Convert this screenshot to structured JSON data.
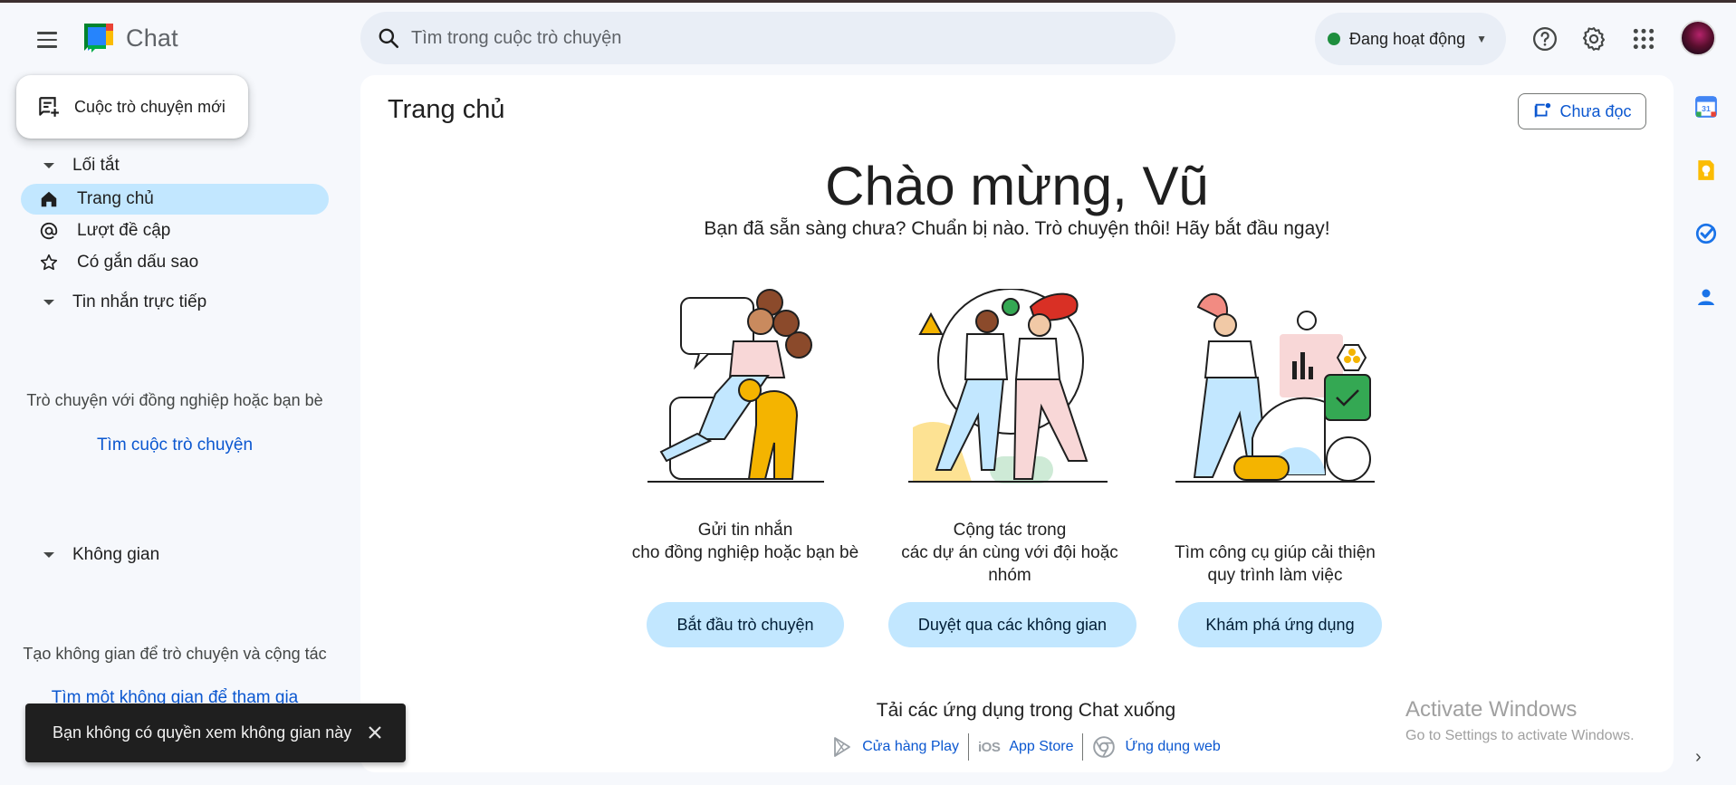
{
  "app": {
    "title": "Chat"
  },
  "search": {
    "placeholder": "Tìm trong cuộc trò chuyện"
  },
  "status": {
    "label": "Đang hoạt động",
    "color": "#1e8e3e"
  },
  "header_icons": [
    "help-icon",
    "settings-gear-icon",
    "apps-grid-icon",
    "account-avatar"
  ],
  "sidebar": {
    "new_chat_label": "Cuộc trò chuyện mới",
    "shortcuts": {
      "title": "Lối tắt",
      "items": [
        {
          "label": "Trang chủ",
          "icon": "home-icon",
          "active": true
        },
        {
          "label": "Lượt đề cập",
          "icon": "at-sign-icon",
          "active": false
        },
        {
          "label": "Có gắn dấu sao",
          "icon": "star-icon",
          "active": false
        }
      ]
    },
    "direct_messages": {
      "title": "Tin nhắn trực tiếp",
      "empty_text": "Trò chuyện với đồng nghiệp hoặc bạn bè",
      "link": "Tìm cuộc trò chuyện"
    },
    "spaces": {
      "title": "Không gian",
      "empty_text": "Tạo không gian để trò chuyện và cộng tác",
      "link": "Tìm một không gian để tham gia"
    }
  },
  "main": {
    "page_title": "Trang chủ",
    "unread_button": "Chưa đọc",
    "welcome": "Chào mừng, Vũ",
    "tagline": "Bạn đã sẵn sàng chưa? Chuẩn bị nào. Trò chuyện thôi! Hãy bắt đầu ngay!",
    "features": [
      {
        "text_line1": "Gửi tin nhắn",
        "text_line2": "cho đồng nghiệp hoặc bạn bè",
        "button": "Bắt đầu trò chuyện"
      },
      {
        "text_line1": "Cộng tác trong",
        "text_line2": "các dự án cùng với đội hoặc nhóm",
        "button": "Duyệt qua các không gian"
      },
      {
        "text_line1": "Tìm công cụ giúp cải thiện",
        "text_line2": "quy trình làm việc",
        "button": "Khám phá ứng dụng"
      }
    ],
    "download": {
      "title": "Tải các ứng dụng trong Chat xuống",
      "stores": [
        {
          "label": "Cửa hàng Play",
          "icon": "play-store-icon"
        },
        {
          "label": "App Store",
          "icon": "ios-icon",
          "glyph": "iOS"
        },
        {
          "label": "Ứng dụng web",
          "icon": "chrome-icon"
        }
      ]
    }
  },
  "watermark": {
    "line1": "Activate Windows",
    "line2": "Go to Settings to activate Windows."
  },
  "right_rail": [
    "calendar-icon",
    "keep-icon",
    "tasks-icon",
    "contacts-icon"
  ],
  "snackbar": {
    "message": "Bạn không có quyền xem không gian này"
  }
}
